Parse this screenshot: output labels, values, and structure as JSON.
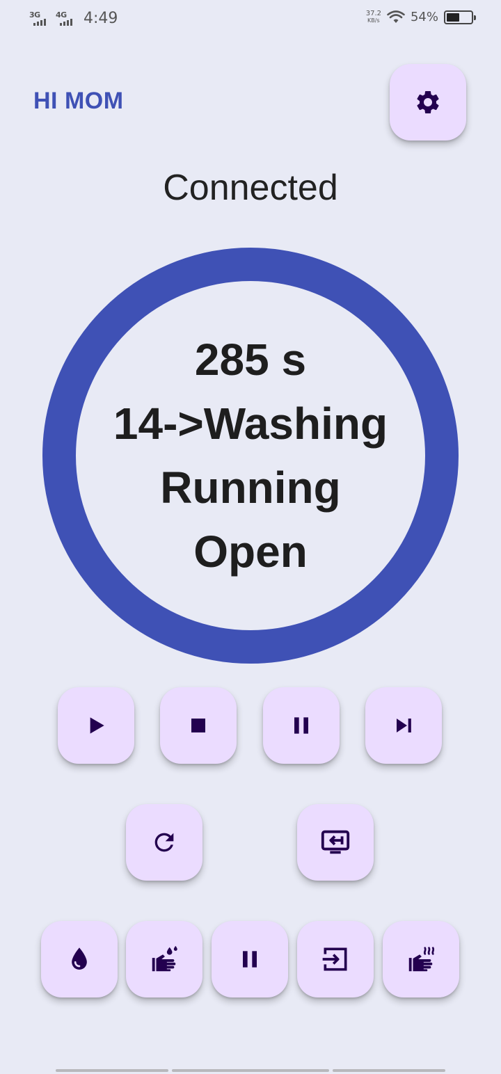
{
  "status_bar": {
    "sim1": "3G",
    "sim2": "4G",
    "time": "4:49",
    "net_speed_value": "37.2",
    "net_speed_unit": "KB/s",
    "battery_percent": "54%",
    "battery_level": 0.54
  },
  "header": {
    "title": "HI MOM"
  },
  "connection_status": "Connected",
  "progress": {
    "time_remaining": "285 s",
    "program": "14->Washing",
    "state": "Running",
    "door": "Open"
  },
  "icons": {
    "settings": "gear-icon",
    "row1": [
      "play-icon",
      "stop-icon",
      "pause-icon",
      "skip-next-icon"
    ],
    "row2": [
      "refresh-icon",
      "screen-return-icon"
    ],
    "row3": [
      "water-drop-icon",
      "wash-hands-icon",
      "pause-icon",
      "enter-icon",
      "dry-hands-icon"
    ]
  },
  "colors": {
    "accent": "#3f51b5",
    "button_bg": "#ebdcff",
    "icon": "#23004f",
    "background": "#e8eaf5"
  }
}
